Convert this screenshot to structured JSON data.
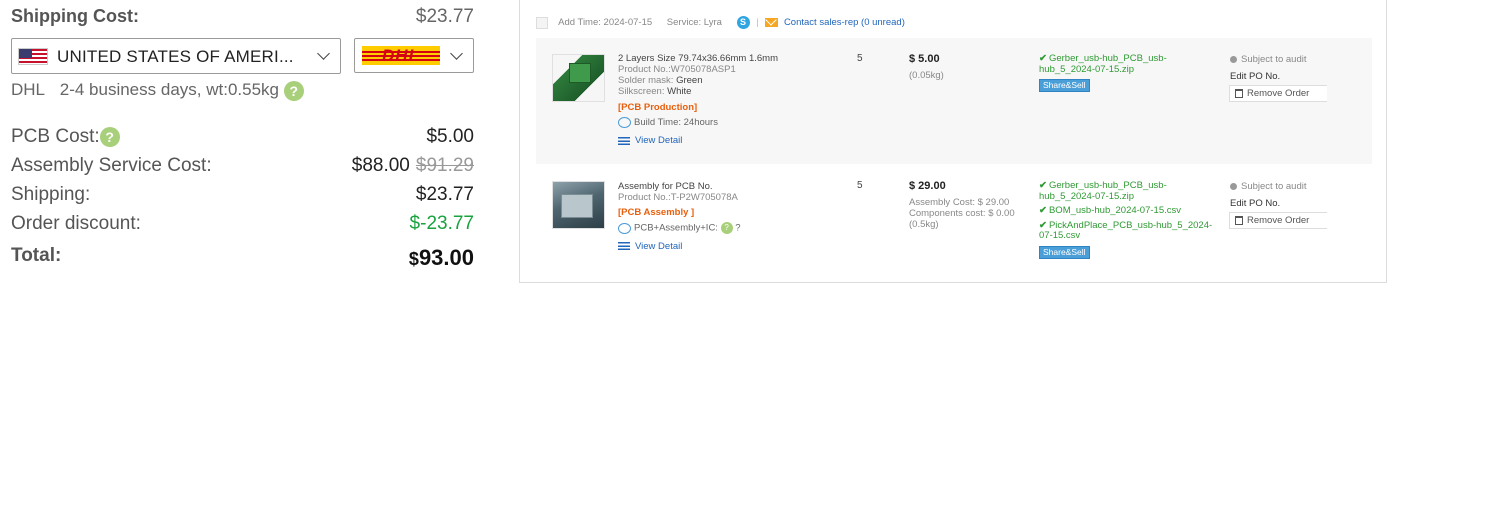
{
  "summary": {
    "shipping_cost_label": "Shipping Cost:",
    "shipping_cost_value": "$23.77",
    "country_value": "UNITED STATES OF AMERI...",
    "carrier_logo_text": "DHL",
    "carrier_name": "DHL",
    "delivery_info": "2-4 business days, wt:0.55kg",
    "help_glyph": "?",
    "pcb_cost_label": "PCB Cost:",
    "pcb_cost_value": "$5.00",
    "assembly_label": "Assembly Service Cost:",
    "assembly_value": "$88.00",
    "assembly_original": "$91.29",
    "shipping_label": "Shipping:",
    "shipping_value": "$23.77",
    "discount_label": "Order discount:",
    "discount_value": "$-23.77",
    "total_label": "Total:",
    "total_currency": "$",
    "total_value": "93.00",
    "colors": {
      "discount": "#19a23e",
      "help_icon": "#a8cf7a"
    }
  },
  "order": {
    "add_time_label": "Add Time:",
    "add_time": "2024-07-15",
    "service_label": "Service:",
    "service_value": "Lyra",
    "skype_glyph": "S",
    "separator": "|",
    "contact_link": "Contact sales-rep (0 unread)",
    "items": [
      {
        "title": "2 Layers Size 79.74x36.66mm 1.6mm",
        "product_no": "Product No.:W705078ASP1",
        "solder_label": "Solder mask:",
        "solder_value": "Green",
        "silk_label": "Silkscreen:",
        "silk_value": "White",
        "tag": "[PCB Production]",
        "build": "Build Time: 24hours",
        "view_detail": "View Detail",
        "qty": "5",
        "price": "$ 5.00",
        "weight": "(0.05kg)",
        "files": [
          "Gerber_usb-hub_PCB_usb-hub_5_2024-07-15.zip"
        ],
        "share_label": "Share&Sell",
        "status": "Subject to audit",
        "edit_po": "Edit PO No.",
        "remove": "Remove Order"
      },
      {
        "title": "Assembly for PCB No.",
        "product_no": "Product No.:T-P2W705078A",
        "tag": "[PCB Assembly ]",
        "combo": "PCB+Assembly+IC:",
        "combo_q": "?",
        "view_detail": "View Detail",
        "qty": "5",
        "price": "$ 29.00",
        "assembly_cost": "Assembly Cost: $ 29.00",
        "components_cost": "Components cost: $ 0.00",
        "weight": "(0.5kg)",
        "files": [
          "Gerber_usb-hub_PCB_usb-hub_5_2024-07-15.zip",
          "BOM_usb-hub_2024-07-15.csv",
          "PickAndPlace_PCB_usb-hub_5_2024-07-15.csv"
        ],
        "share_label": "Share&Sell",
        "status": "Subject to audit",
        "edit_po": "Edit PO No.",
        "remove": "Remove Order"
      }
    ]
  }
}
